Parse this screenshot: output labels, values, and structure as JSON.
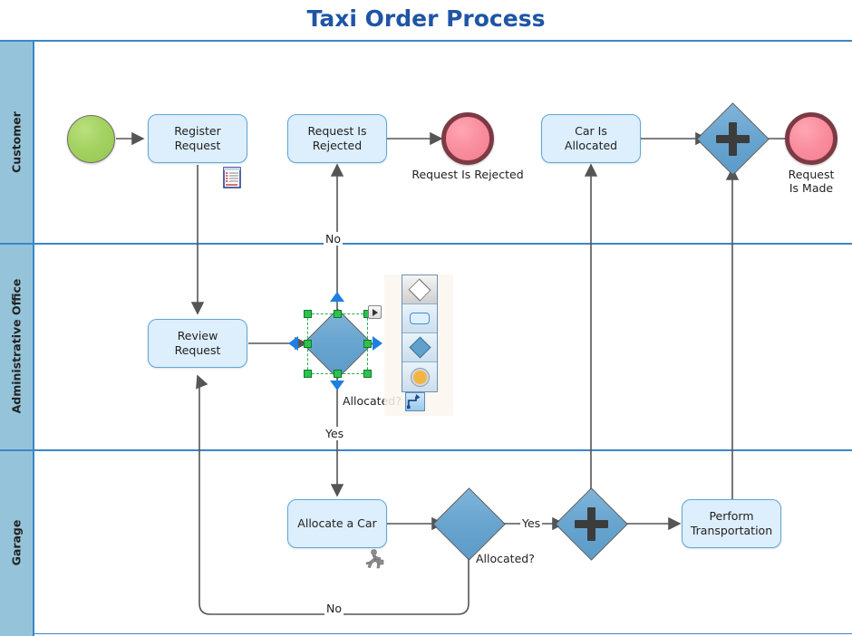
{
  "title": "Taxi Order Process",
  "lanes": [
    {
      "label": "Customer"
    },
    {
      "label": "Administrative Office"
    },
    {
      "label": "Garage"
    }
  ],
  "nodes": {
    "start_event": {
      "type": "start-event",
      "label": ""
    },
    "register_request": {
      "label": "Register\nRequest",
      "line1": "Register",
      "line2": "Request"
    },
    "request_is_rejected_task": {
      "line1": "Request Is",
      "line2": "Rejected"
    },
    "request_is_rejected_end": {
      "label": "Request Is Rejected"
    },
    "car_is_allocated": {
      "line1": "Car Is",
      "line2": "Allocated"
    },
    "join_gateway_customer": {
      "label": ""
    },
    "request_is_made_end": {
      "line1": "Request",
      "line2": "Is Made"
    },
    "review_request": {
      "line1": "Review",
      "line2": "Request"
    },
    "allocated_gateway_admin": {
      "label": "Allocated?"
    },
    "allocate_a_car": {
      "label": "Allocate a Car"
    },
    "allocated_gateway_garage": {
      "label": "Allocated?"
    },
    "join_gateway_garage": {
      "label": ""
    },
    "perform_transportation": {
      "line1": "Perform",
      "line2": "Transportation"
    }
  },
  "flow_labels": {
    "no_top": "No",
    "yes_admin": "Yes",
    "yes_garage": "Yes",
    "no_bottom": "No"
  },
  "palette": {
    "items": [
      {
        "name": "diamond-outline-shape",
        "selected": true
      },
      {
        "name": "rounded-rectangle-shape",
        "selected": false
      },
      {
        "name": "blue-diamond-shape",
        "selected": false
      },
      {
        "name": "orange-circle-shape",
        "selected": false
      }
    ],
    "connector_tool": "connector-tool"
  },
  "colors": {
    "title": "#1f55a5",
    "lane_header": "#95c4da",
    "lane_border": "#3b87c8",
    "task_fill": "#ddeefc",
    "task_border": "#5ea7da",
    "gateway_fill": "#66a3ce",
    "start_fill": "#a4d262",
    "end_fill": "#f98d9e",
    "end_ring": "#7c3a44",
    "selection_handle": "#2fc14e",
    "connection_arrow": "#1f7fe0",
    "flow_line": "#555555"
  }
}
